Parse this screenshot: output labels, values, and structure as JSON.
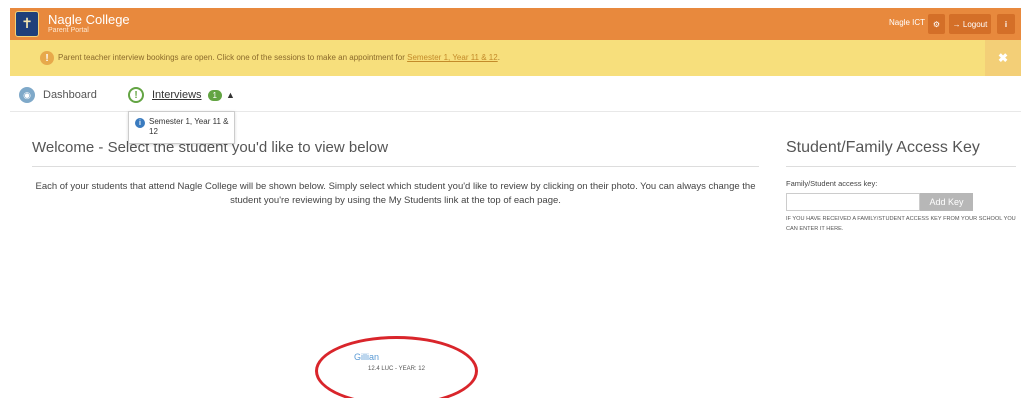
{
  "header": {
    "brand_title": "Nagle College",
    "brand_subtitle": "Parent Portal",
    "user_label": "Nagle ICT",
    "logout_label": "→ Logout",
    "gear_icon": "gear-icon",
    "info_icon": "info-icon",
    "color": "#e8893d"
  },
  "alert": {
    "text": "Parent teacher interview bookings are open. Click one of the sessions to make an appointment for",
    "link_text": "Semester 1, Year 11 & 12",
    "trailing": ".",
    "close_glyph": "✖",
    "color": "#f7df7c"
  },
  "nav": {
    "dashboard_label": "Dashboard",
    "interviews_label": "Interviews",
    "interviews_count": "1",
    "dropdown_item": "Semester 1, Year 11 & 12"
  },
  "main": {
    "welcome_title": "Welcome - Select the student you'd like to view below",
    "intro_text": "Each of your students that attend Nagle College will be shown below. Simply select which student you'd like to review by clicking on their photo. You can always change the student you're reviewing by using the My Students link at the top of each page."
  },
  "student": {
    "name": "Gillian",
    "detail": "12.4 LUC - YEAR: 12"
  },
  "access_key": {
    "title": "Student/Family Access Key",
    "label": "Family/Student access key:",
    "input_value": "",
    "button_label": "Add Key",
    "note": "IF YOU HAVE RECEIVED A FAMILY/STUDENT ACCESS KEY FROM YOUR SCHOOL YOU CAN ENTER IT HERE."
  }
}
